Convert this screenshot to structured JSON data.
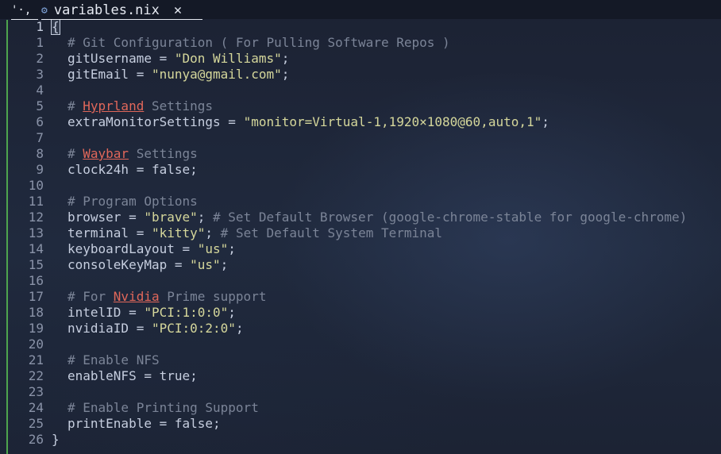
{
  "tabs": [
    {
      "label": "'·,",
      "active": false
    },
    {
      "label": "variables.nix",
      "icon": "gear-icon",
      "close": "✕",
      "active": true
    }
  ],
  "colors": {
    "background": "#1d2436",
    "comment": "#7b8497",
    "string": "#d5d79b",
    "spell_error": "#e0675a",
    "git_added_bar": "#4ea44e"
  },
  "cursor_line": 1,
  "lines": [
    {
      "num": "1",
      "segments": [
        {
          "text": "{",
          "type": "brace-cur"
        }
      ]
    },
    {
      "num": "1",
      "indent": true,
      "segments": [
        {
          "text": "# Git Configuration ( For Pulling Software Repos )",
          "type": "cm"
        }
      ]
    },
    {
      "num": "2",
      "indent": true,
      "segments": [
        {
          "text": "gitUsername = ",
          "type": "plain"
        },
        {
          "text": "\"Don Williams\"",
          "type": "str"
        },
        {
          "text": ";",
          "type": "plain"
        }
      ]
    },
    {
      "num": "3",
      "indent": true,
      "segments": [
        {
          "text": "gitEmail = ",
          "type": "plain"
        },
        {
          "text": "\"nunya@gmail.com\"",
          "type": "str"
        },
        {
          "text": ";",
          "type": "plain"
        }
      ]
    },
    {
      "num": "4",
      "segments": []
    },
    {
      "num": "5",
      "indent": true,
      "segments": [
        {
          "text": "# ",
          "type": "cm"
        },
        {
          "text": "Hyprland",
          "type": "warn"
        },
        {
          "text": " Settings",
          "type": "cm"
        }
      ]
    },
    {
      "num": "6",
      "indent": true,
      "segments": [
        {
          "text": "extraMonitorSettings = ",
          "type": "plain"
        },
        {
          "text": "\"monitor=Virtual-1,1920×1080@60,auto,1\"",
          "type": "str"
        },
        {
          "text": ";",
          "type": "plain"
        }
      ]
    },
    {
      "num": "7",
      "segments": []
    },
    {
      "num": "8",
      "indent": true,
      "segments": [
        {
          "text": "# ",
          "type": "cm"
        },
        {
          "text": "Waybar",
          "type": "warn"
        },
        {
          "text": " Settings",
          "type": "cm"
        }
      ]
    },
    {
      "num": "9",
      "indent": true,
      "segments": [
        {
          "text": "clock24h = false;",
          "type": "plain"
        }
      ]
    },
    {
      "num": "10",
      "segments": []
    },
    {
      "num": "11",
      "indent": true,
      "segments": [
        {
          "text": "# Program Options",
          "type": "cm"
        }
      ]
    },
    {
      "num": "12",
      "indent": true,
      "segments": [
        {
          "text": "browser = ",
          "type": "plain"
        },
        {
          "text": "\"brave\"",
          "type": "str"
        },
        {
          "text": "; ",
          "type": "plain"
        },
        {
          "text": "# Set Default Browser (google-chrome-stable for google-chrome)",
          "type": "cm"
        }
      ]
    },
    {
      "num": "13",
      "indent": true,
      "segments": [
        {
          "text": "terminal = ",
          "type": "plain"
        },
        {
          "text": "\"kitty\"",
          "type": "str"
        },
        {
          "text": "; ",
          "type": "plain"
        },
        {
          "text": "# Set Default System Terminal",
          "type": "cm"
        }
      ]
    },
    {
      "num": "14",
      "indent": true,
      "segments": [
        {
          "text": "keyboardLayout = ",
          "type": "plain"
        },
        {
          "text": "\"us\"",
          "type": "str"
        },
        {
          "text": ";",
          "type": "plain"
        }
      ]
    },
    {
      "num": "15",
      "indent": true,
      "segments": [
        {
          "text": "consoleKeyMap = ",
          "type": "plain"
        },
        {
          "text": "\"us\"",
          "type": "str"
        },
        {
          "text": ";",
          "type": "plain"
        }
      ]
    },
    {
      "num": "16",
      "segments": []
    },
    {
      "num": "17",
      "indent": true,
      "segments": [
        {
          "text": "# For ",
          "type": "cm"
        },
        {
          "text": "Nvidia",
          "type": "warn"
        },
        {
          "text": " Prime support",
          "type": "cm"
        }
      ]
    },
    {
      "num": "18",
      "indent": true,
      "segments": [
        {
          "text": "intelID = ",
          "type": "plain"
        },
        {
          "text": "\"PCI:1:0:0\"",
          "type": "str"
        },
        {
          "text": ";",
          "type": "plain"
        }
      ]
    },
    {
      "num": "19",
      "indent": true,
      "segments": [
        {
          "text": "nvidiaID = ",
          "type": "plain"
        },
        {
          "text": "\"PCI:0:2:0\"",
          "type": "str"
        },
        {
          "text": ";",
          "type": "plain"
        }
      ]
    },
    {
      "num": "20",
      "segments": []
    },
    {
      "num": "21",
      "indent": true,
      "segments": [
        {
          "text": "# Enable NFS",
          "type": "cm"
        }
      ]
    },
    {
      "num": "22",
      "indent": true,
      "segments": [
        {
          "text": "enableNFS = true;",
          "type": "plain"
        }
      ]
    },
    {
      "num": "23",
      "segments": []
    },
    {
      "num": "24",
      "indent": true,
      "segments": [
        {
          "text": "# Enable Printing Support",
          "type": "cm"
        }
      ]
    },
    {
      "num": "25",
      "indent": true,
      "segments": [
        {
          "text": "printEnable = false;",
          "type": "plain"
        }
      ]
    },
    {
      "num": "26",
      "segments": [
        {
          "text": "}",
          "type": "plain"
        }
      ]
    }
  ]
}
